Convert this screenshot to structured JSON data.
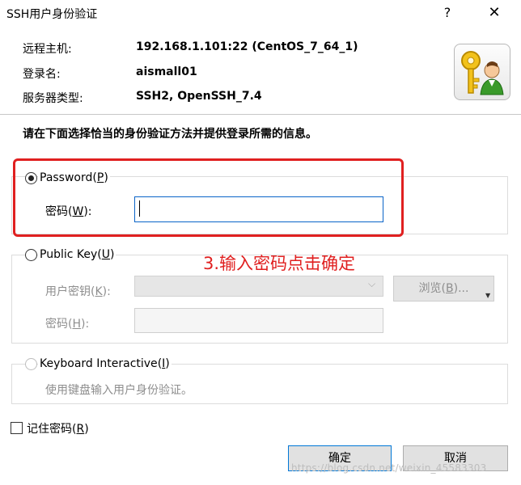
{
  "window": {
    "title": "SSH用户身份验证",
    "help_glyph": "?",
    "close_glyph": "✕"
  },
  "info": [
    {
      "label": "远程主机:",
      "value": "192.168.1.101:22 (CentOS_7_64_1)"
    },
    {
      "label": "登录名:",
      "value": "aismall01"
    },
    {
      "label": "服务器类型:",
      "value": "SSH2, OpenSSH_7.4"
    }
  ],
  "instruction": "请在下面选择恰当的身份验证方法并提供登录所需的信息。",
  "password_group": {
    "label": "Password",
    "accel": "P",
    "field_label": "密码",
    "field_accel": "W",
    "value": ""
  },
  "pubkey_group": {
    "label": "Public Key",
    "accel": "U",
    "userkey_label": "用户密钥",
    "userkey_accel": "K",
    "passphrase_label": "密码",
    "passphrase_accel": "H",
    "browse_label": "浏览",
    "browse_accel": "B"
  },
  "keyboard_group": {
    "label": "Keyboard Interactive",
    "accel": "I",
    "description": "使用键盘输入用户身份验证。"
  },
  "annotation": "3.输入密码点击确定",
  "remember": {
    "label": "记住密码",
    "accel": "R"
  },
  "buttons": {
    "ok": "确定",
    "cancel": "取消"
  },
  "watermark": "https://blog.csdn.net/weixin_45583303",
  "colors": {
    "annotation_red": "#e02020",
    "focus_blue": "#0a64c8",
    "default_button_border": "#0078d7"
  }
}
